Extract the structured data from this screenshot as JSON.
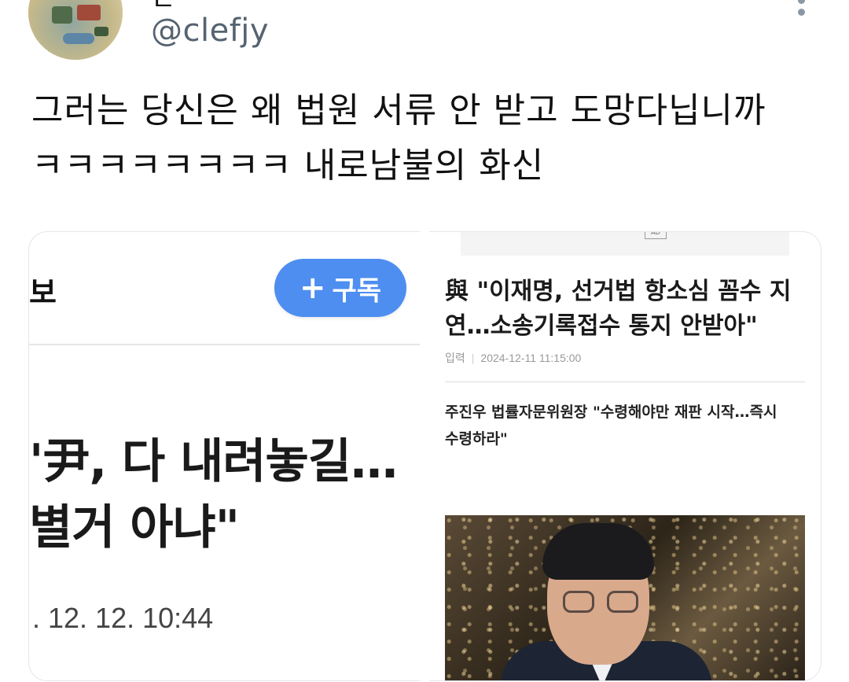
{
  "header": {
    "name_fragment": "ㄴ",
    "handle": "@clefjy",
    "avatar_icon": "profile-avatar-photo",
    "more_icon": "more-vertical-icon"
  },
  "tweet": {
    "text": "그러는 당신은 왜 법원 서류 안 받고 도망다닙니까\nㅋㅋㅋㅋㅋㅋㅋㅋ 내로남불의 화신"
  },
  "left_card": {
    "press_fragment": "보",
    "subscribe_label": "구독",
    "subscribe_icon": "plus-icon",
    "headline": "'尹, 다 내려놓길…\n별거 아냐\"",
    "date": ". 12. 12. 10:44"
  },
  "right_card": {
    "ad_label": "AD",
    "headline": "與 \"이재명, 선거법 항소심 꼼수 지\n연…소송기록접수 통지 안받아\"",
    "meta_label": "입력",
    "meta_date": "2024-12-11 11:15:00",
    "subhead": "주진우 법률자문위원장 \"수령해야만 재판 시작…즉시\n수령하라\"",
    "photo_icon": "news-photo"
  },
  "colors": {
    "subscribe_button": "#4d8ef0",
    "handle": "#566370"
  }
}
